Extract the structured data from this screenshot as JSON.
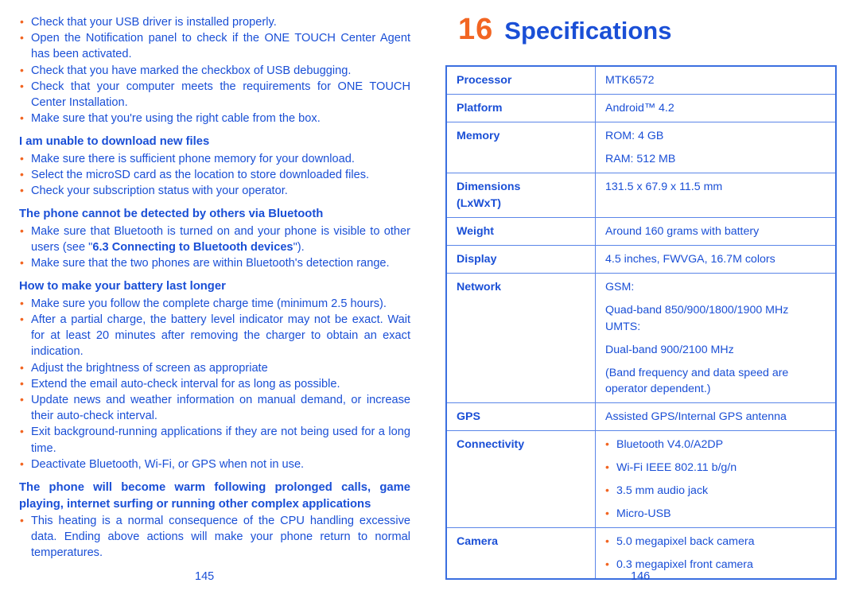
{
  "colors": {
    "text_blue": "#1a4fd6",
    "bullet_orange": "#f26522",
    "table_border": "#5b86e8",
    "chapter_number_orange": "#f26522"
  },
  "left_page": {
    "page_number": "145",
    "groups": [
      {
        "heading": null,
        "bullets": [
          "Check that your USB driver is installed properly.",
          "Open the Notification panel to check if the ONE TOUCH Center Agent has been activated.",
          "Check that you have marked the checkbox of USB debugging.",
          "Check that your computer meets the requirements for ONE TOUCH Center Installation.",
          "Make sure that you're using the right cable from the box."
        ]
      },
      {
        "heading": "I am unable to download new files",
        "bullets": [
          "Make sure there is sufficient phone memory for your download.",
          "Select the microSD card as the location to store downloaded files.",
          "Check your subscription status with your operator."
        ]
      },
      {
        "heading": "The phone cannot be detected by others via Bluetooth",
        "bullets": [
          "Make sure that Bluetooth is turned on and your phone is visible to other users (see \"6.3 Connecting to Bluetooth devices\").",
          "Make sure that the two phones are within Bluetooth's detection range."
        ],
        "bold_fragment": "6.3 Connecting to Bluetooth devices"
      },
      {
        "heading": "How to make your battery last longer",
        "bullets": [
          "Make sure you follow the complete charge time (minimum 2.5 hours).",
          "After a partial charge, the battery level indicator may not be exact. Wait for at least 20 minutes after removing the charger to obtain an exact indication.",
          "Adjust the brightness of screen as appropriate",
          "Extend the email auto-check interval for as long as possible.",
          "Update news and weather information on manual demand, or increase their auto-check interval.",
          "Exit background-running applications if they are not being used for a long time.",
          "Deactivate Bluetooth, Wi-Fi, or GPS when not in use."
        ]
      },
      {
        "heading_line_1": "The phone will become warm following prolonged calls, game",
        "heading_line_2": "playing, internet surfing or running other complex applications",
        "bullets": [
          "This heating is a normal consequence of the CPU handling excessive data. Ending above actions will make your phone return to normal temperatures."
        ]
      }
    ]
  },
  "right_page": {
    "page_number": "146",
    "chapter": {
      "number": "16",
      "name": "Specifications"
    },
    "spec_table": {
      "rows": [
        {
          "label": "Processor",
          "values": [
            "MTK6572"
          ],
          "style": "plain"
        },
        {
          "label": "Platform",
          "values": [
            "Android™ 4.2"
          ],
          "style": "plain"
        },
        {
          "label": "Memory",
          "values": [
            "ROM: 4 GB",
            "RAM: 512 MB"
          ],
          "style": "spaced"
        },
        {
          "label": "Dimensions (LxWxT)",
          "label_line_1": "Dimensions",
          "label_line_2": "(LxWxT)",
          "values": [
            "131.5 x 67.9 x 11.5 mm"
          ],
          "style": "plain"
        },
        {
          "label": "Weight",
          "values": [
            "Around 160 grams with battery"
          ],
          "style": "plain"
        },
        {
          "label": "Display",
          "values": [
            "4.5 inches, FWVGA, 16.7M colors"
          ],
          "style": "plain"
        },
        {
          "label": "Network",
          "values": [
            "GSM:",
            "Quad-band 850/900/1800/1900 MHz",
            "UMTS:",
            "Dual-band 900/2100 MHz",
            "(Band frequency and data speed are operator dependent.)"
          ],
          "style": "spaced"
        },
        {
          "label": "GPS",
          "values": [
            "Assisted GPS/Internal GPS antenna"
          ],
          "style": "plain"
        },
        {
          "label": "Connectivity",
          "values": [
            "Bluetooth V4.0/A2DP",
            "Wi-Fi IEEE 802.11 b/g/n",
            "3.5 mm audio jack",
            "Micro-USB"
          ],
          "style": "bulleted"
        },
        {
          "label": "Camera",
          "values": [
            "5.0 megapixel back camera",
            "0.3 megapixel front camera"
          ],
          "style": "bulleted"
        }
      ]
    }
  }
}
